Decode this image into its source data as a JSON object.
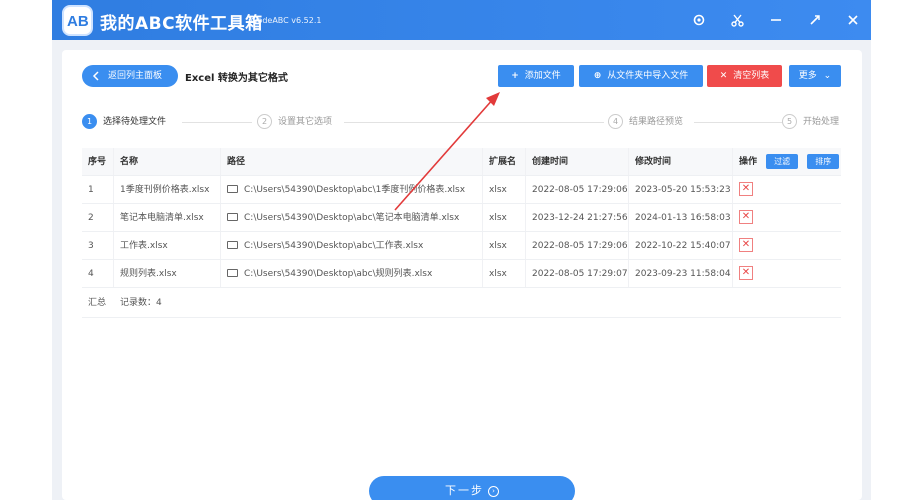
{
  "app": {
    "title": "我的ABC软件工具箱",
    "version": "WodeABC v6.52.1",
    "logo_text": "AB"
  },
  "titlebar": {
    "icons": [
      "gear-icon",
      "scissors-icon",
      "minimize-icon",
      "maximize-icon",
      "close-icon"
    ]
  },
  "header": {
    "back_label": "返回列主面板",
    "page_title": "Excel 转换为其它格式"
  },
  "toolbar": {
    "add_label": "添加文件",
    "import_label": "从文件夹中导入文件",
    "clear_label": "清空列表",
    "more_label": "更多"
  },
  "steps": [
    {
      "num": "1",
      "label": "选择待处理文件"
    },
    {
      "num": "2",
      "label": "设置其它选项"
    },
    {
      "num": "4",
      "label": "结果路径预览"
    },
    {
      "num": "5",
      "label": "开始处理"
    }
  ],
  "table": {
    "headers": {
      "seq": "序号",
      "name": "名称",
      "path": "路径",
      "ext": "扩展名",
      "ctime": "创建时间",
      "mtime": "修改时间",
      "op": "操作",
      "filter": "过滤",
      "sort": "排序"
    },
    "rows": [
      {
        "seq": "1",
        "name": "1季度刊例价格表.xlsx",
        "path": "C:\\Users\\54390\\Desktop\\abc\\1季度刊例价格表.xlsx",
        "ext": "xlsx",
        "ctime": "2022-08-05 17:29:06",
        "mtime": "2023-05-20 15:53:23"
      },
      {
        "seq": "2",
        "name": "笔记本电脑清单.xlsx",
        "path": "C:\\Users\\54390\\Desktop\\abc\\笔记本电脑清单.xlsx",
        "ext": "xlsx",
        "ctime": "2023-12-24 21:27:56",
        "mtime": "2024-01-13 16:58:03"
      },
      {
        "seq": "3",
        "name": "工作表.xlsx",
        "path": "C:\\Users\\54390\\Desktop\\abc\\工作表.xlsx",
        "ext": "xlsx",
        "ctime": "2022-08-05 17:29:06",
        "mtime": "2022-10-22 15:40:07"
      },
      {
        "seq": "4",
        "name": "规则列表.xlsx",
        "path": "C:\\Users\\54390\\Desktop\\abc\\规则列表.xlsx",
        "ext": "xlsx",
        "ctime": "2022-08-05 17:29:07",
        "mtime": "2023-09-23 11:58:04"
      }
    ],
    "summary": {
      "label": "汇总",
      "count": "记录数：4"
    }
  },
  "footer": {
    "next_label": "下一步"
  },
  "colors": {
    "primary": "#3a8ef0",
    "danger": "#f04b4b",
    "titlebar": "#2f7de1",
    "annotation_arrow": "#e23a3a"
  }
}
